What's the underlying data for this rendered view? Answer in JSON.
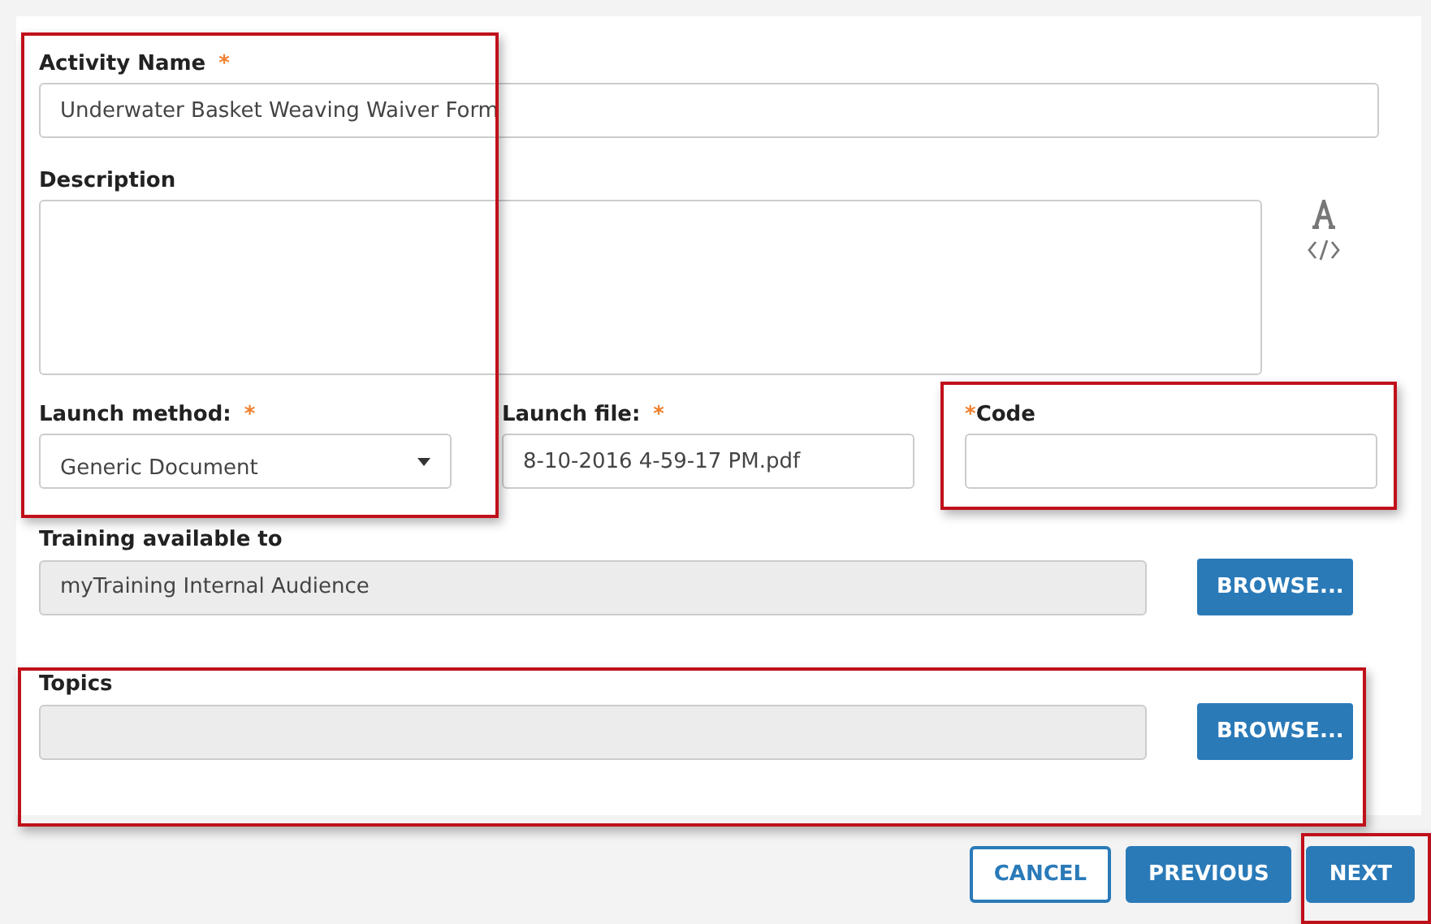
{
  "activity_name": {
    "label": "Activity Name",
    "asterisk": "*",
    "asterisk_first": false,
    "value": "Underwater Basket Weaving Waiver Form"
  },
  "description": {
    "label": "Description"
  },
  "launch_method": {
    "label": "Launch method:",
    "asterisk": "*",
    "asterisk_first": false,
    "value": "Generic Document"
  },
  "launch_file": {
    "label": "Launch file:",
    "asterisk": "*",
    "asterisk_first": false,
    "value": "8-10-2016 4-59-17 PM.pdf"
  },
  "code": {
    "label": "Code",
    "asterisk": "*",
    "asterisk_first": true
  },
  "training_available_to": {
    "label": "Training available to",
    "value": "myTraining Internal Audience",
    "disabled": true,
    "button": "BROWSE..."
  },
  "topics": {
    "label": "Topics",
    "disabled": true,
    "button": "BROWSE..."
  },
  "footer_buttons": [
    {
      "label": "CANCEL",
      "kind": "outline"
    },
    {
      "label": "PREVIOUS",
      "kind": "primary"
    },
    {
      "label": "NEXT",
      "kind": "primary"
    }
  ]
}
